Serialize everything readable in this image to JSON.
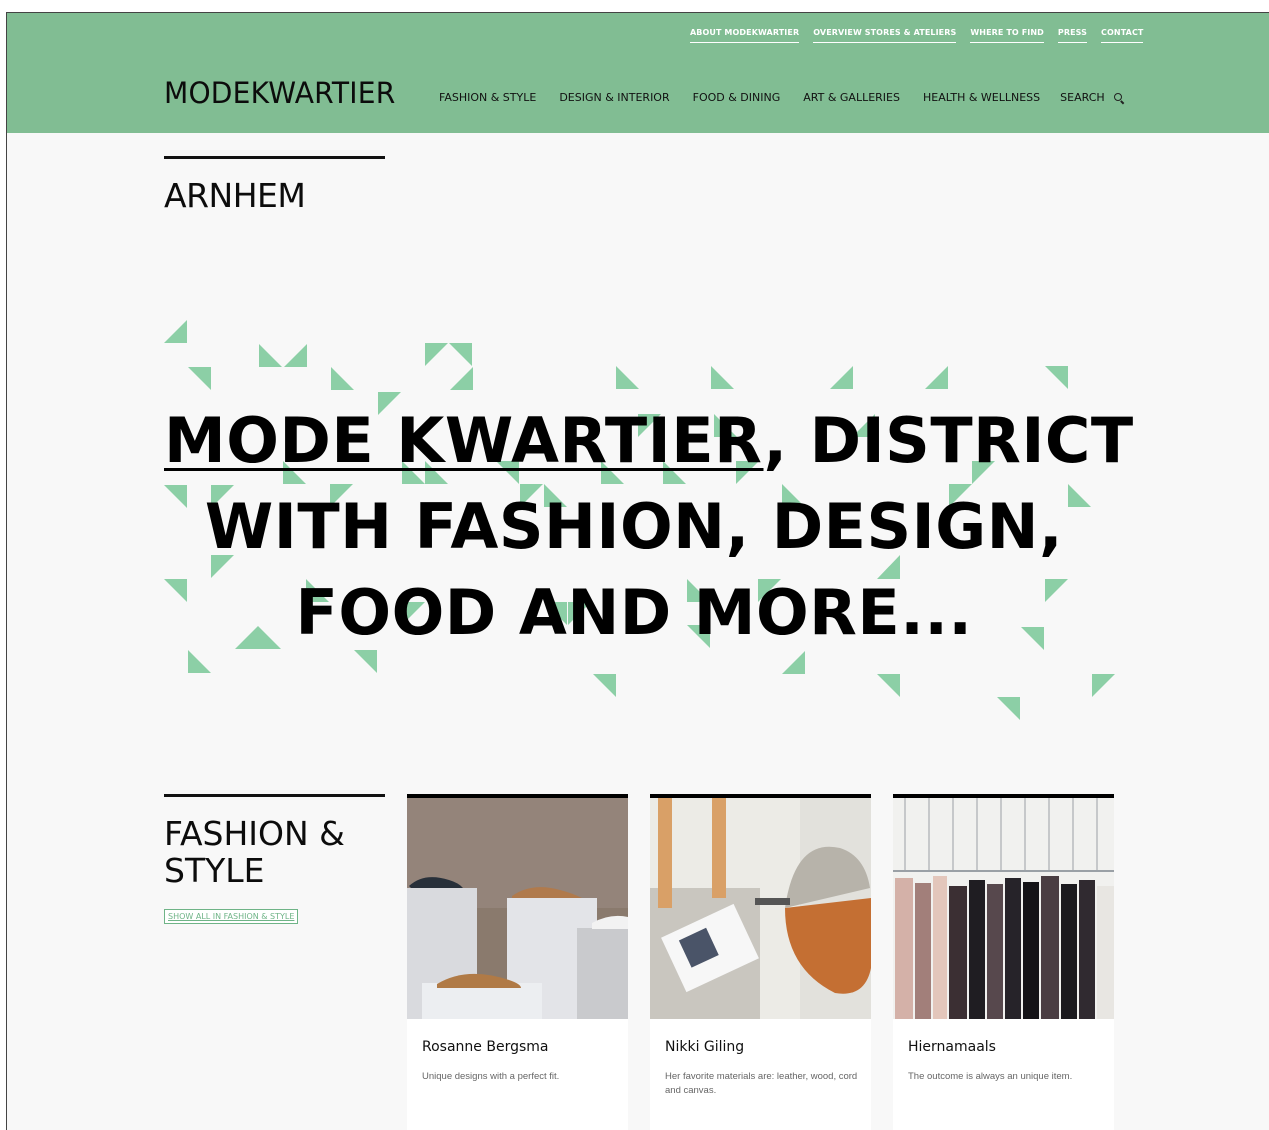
{
  "top_nav": [
    "ABOUT MODEKWARTIER",
    "OVERVIEW STORES & ATELIERS",
    "WHERE TO FIND",
    "PRESS",
    "CONTACT"
  ],
  "logo": "MODEKWARTIER",
  "main_nav": [
    "FASHION & STYLE",
    "DESIGN & INTERIOR",
    "FOOD & DINING",
    "ART & GALLERIES",
    "HEALTH & WELLNESS"
  ],
  "search_label": "SEARCH",
  "city": "ARNHEM",
  "hero": {
    "link_text": "MODE KWARTIER",
    "line1_rest": ", DISTRICT",
    "line2": "WITH FASHION, DESIGN,",
    "line3": "FOOD AND MORE..."
  },
  "section": {
    "title": "FASHION & STYLE",
    "show_all": "SHOW ALL IN FASHION & STYLE"
  },
  "cards": [
    {
      "name": "Rosanne Bergsma",
      "desc": "Unique designs with a perfect fit."
    },
    {
      "name": "Nikki Giling",
      "desc": "Her favorite materials are: leather, wood, cord and canvas."
    },
    {
      "name": "Hiernamaals",
      "desc": "The outcome is always an unique item."
    }
  ],
  "colors": {
    "brand_green": "#81bd93",
    "triangle_green": "#8ccfa6",
    "text": "#111111"
  }
}
